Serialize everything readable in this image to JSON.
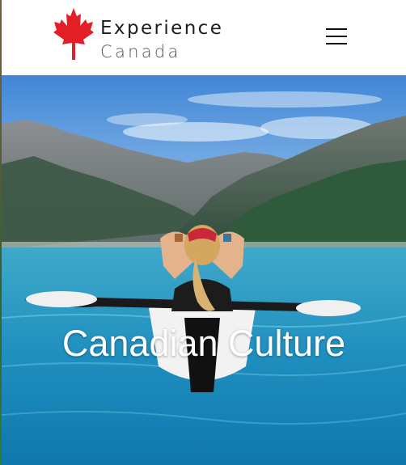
{
  "header": {
    "brand_line1": "Experience",
    "brand_line2": "Canada",
    "logo_icon": "maple-leaf-icon",
    "menu_icon": "hamburger-menu-icon"
  },
  "hero": {
    "title": "Canadian Culture"
  },
  "colors": {
    "brand_red": "#e41e26",
    "header_bg": "#ffffff",
    "hero_text": "#ffffff"
  }
}
